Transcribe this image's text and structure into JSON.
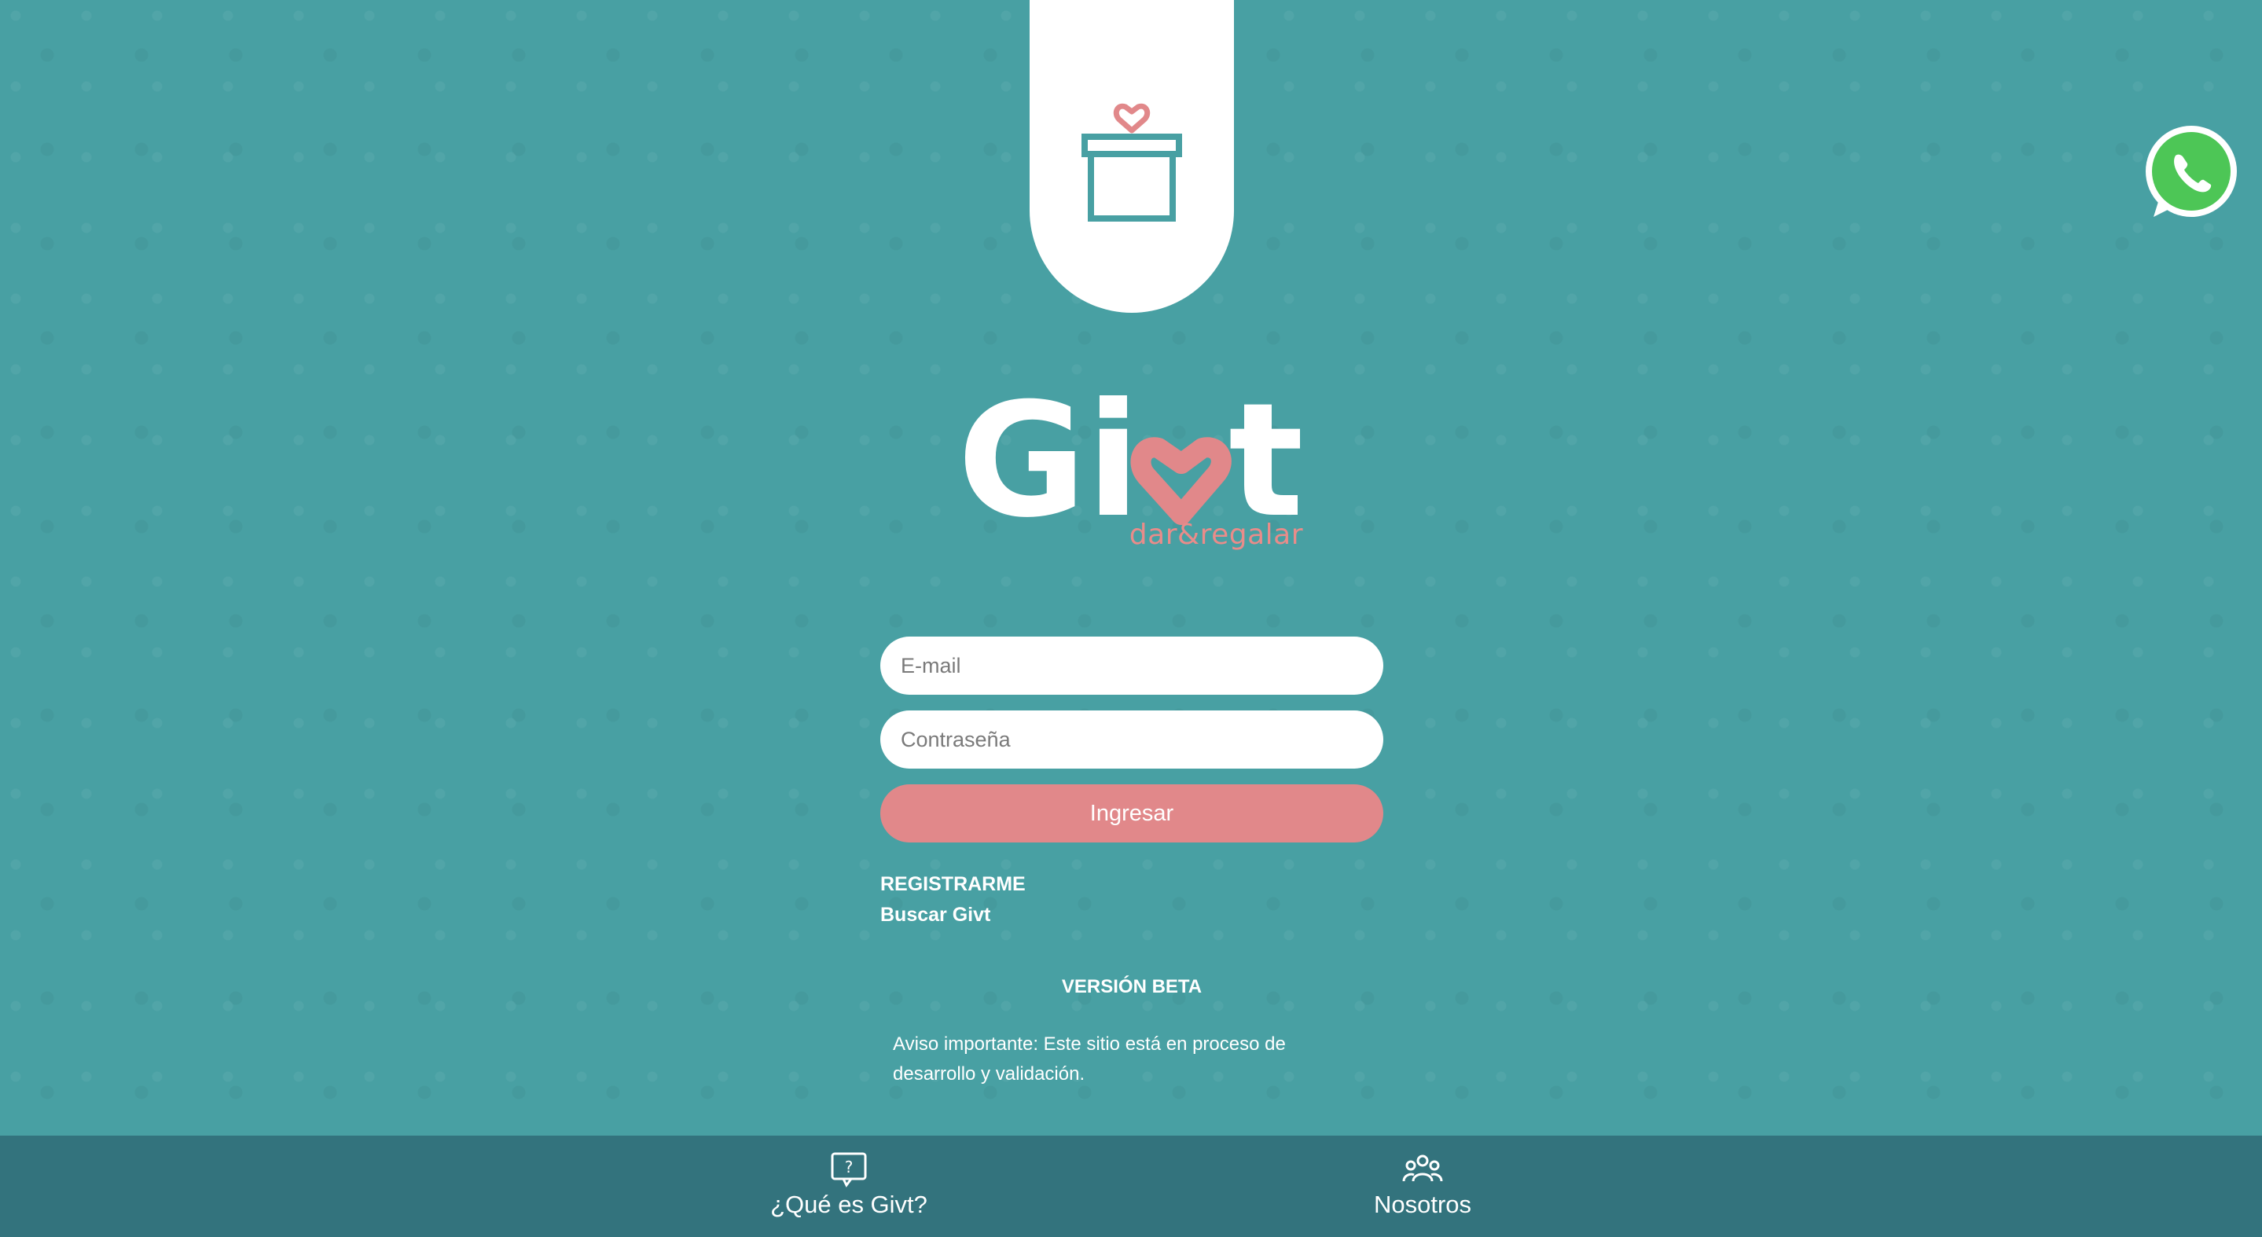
{
  "brand": {
    "name_prefix": "Gi",
    "name_suffix": "t",
    "tagline": "dar&regalar",
    "primary_color": "#48a0a3",
    "accent_color": "#e1888a",
    "footer_color": "#33737d"
  },
  "form": {
    "email_placeholder": "E-mail",
    "password_placeholder": "Contraseña",
    "login_label": "Ingresar"
  },
  "links": {
    "register": "REGISTRARME",
    "search": "Buscar Givt"
  },
  "beta": {
    "title": "VERSIÓN BETA",
    "notice": "Aviso importante: Este sitio está en proceso de desarrollo y validación."
  },
  "footer": {
    "items": [
      {
        "label": "¿Qué es Givt?",
        "icon": "question-bubble-icon"
      },
      {
        "label": "Nosotros",
        "icon": "people-group-icon"
      }
    ]
  },
  "icons": {
    "top": "gift-heart-icon",
    "floating": "whatsapp-icon"
  }
}
